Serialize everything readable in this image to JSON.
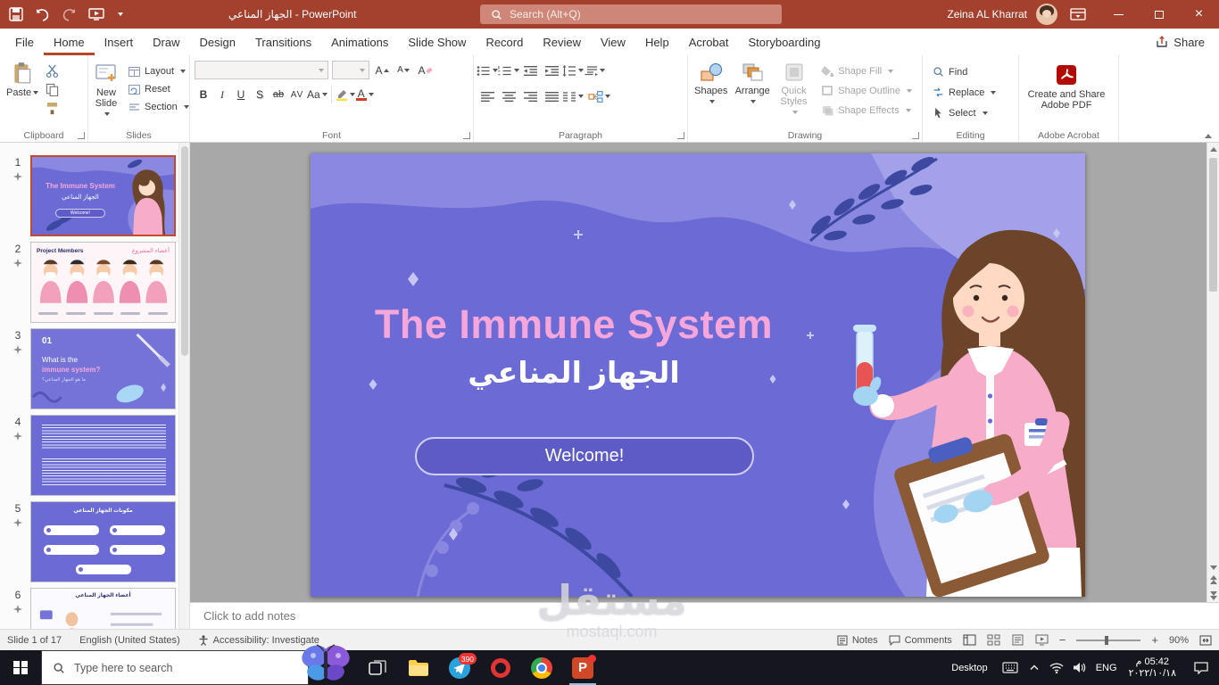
{
  "titlebar": {
    "title": "الجهاز المناعي  -  PowerPoint",
    "search_placeholder": "Search (Alt+Q)",
    "user_name": "Zeina AL Kharrat"
  },
  "menubar": {
    "tabs": [
      "File",
      "Home",
      "Insert",
      "Draw",
      "Design",
      "Transitions",
      "Animations",
      "Slide Show",
      "Record",
      "Review",
      "View",
      "Help",
      "Acrobat",
      "Storyboarding"
    ],
    "share_label": "Share"
  },
  "ribbon": {
    "clipboard": {
      "group": "Clipboard",
      "paste": "Paste"
    },
    "slides": {
      "group": "Slides",
      "new_slide": "New Slide",
      "layout": "Layout",
      "reset": "Reset",
      "section": "Section"
    },
    "font": {
      "group": "Font",
      "buttons": [
        "B",
        "I",
        "U",
        "S",
        "ab",
        "AV",
        "Aa"
      ],
      "color_letter": "A"
    },
    "paragraph": {
      "group": "Paragraph"
    },
    "drawing": {
      "group": "Drawing",
      "shapes": "Shapes",
      "arrange": "Arrange",
      "quick_styles": "Quick Styles",
      "shape_fill": "Shape Fill",
      "shape_outline": "Shape Outline",
      "shape_effects": "Shape Effects"
    },
    "editing": {
      "group": "Editing",
      "find": "Find",
      "replace": "Replace",
      "select": "Select"
    },
    "acrobat": {
      "group": "Adobe Acrobat",
      "create_pdf": "Create and Share Adobe PDF"
    }
  },
  "slide_panel": {
    "slides": [
      {
        "num": "1",
        "title": "The Immune System",
        "subtitle": "الجهاز المناعي"
      },
      {
        "num": "2",
        "title": "Project Members",
        "subtitle": "أعضاء المشروع"
      },
      {
        "num": "3",
        "badge": "01",
        "line1": "What is the",
        "line2": "immune system?",
        "sub": "ما هو الجهاز المناعي؟"
      },
      {
        "num": "4"
      },
      {
        "num": "5",
        "title": "مكونات الجهاز المناعي"
      },
      {
        "num": "6",
        "title": "أعضاء الجهاز المناعي"
      }
    ]
  },
  "slide": {
    "title": "The Immune System",
    "subtitle": "الجهاز المناعي",
    "welcome_button": "Welcome!"
  },
  "notes": {
    "placeholder": "Click to add notes"
  },
  "statusbar": {
    "slide_counter": "Slide 1 of 17",
    "language": "English (United States)",
    "accessibility": "Accessibility: Investigate",
    "notes_label": "Notes",
    "comments_label": "Comments",
    "zoom_level": "90%"
  },
  "taskbar": {
    "search_placeholder": "Type here to search",
    "desktop_label": "Desktop",
    "language": "ENG",
    "time": "05:42 م",
    "date": "٢٠٢٢/١٠/١٨",
    "telegram_badge": "390",
    "powerpoint_letter": "P"
  },
  "watermark": {
    "name": "مستقل",
    "site": "mostaql.com"
  },
  "glyphs": {
    "close": "×",
    "minus": "−",
    "plus": "+"
  }
}
